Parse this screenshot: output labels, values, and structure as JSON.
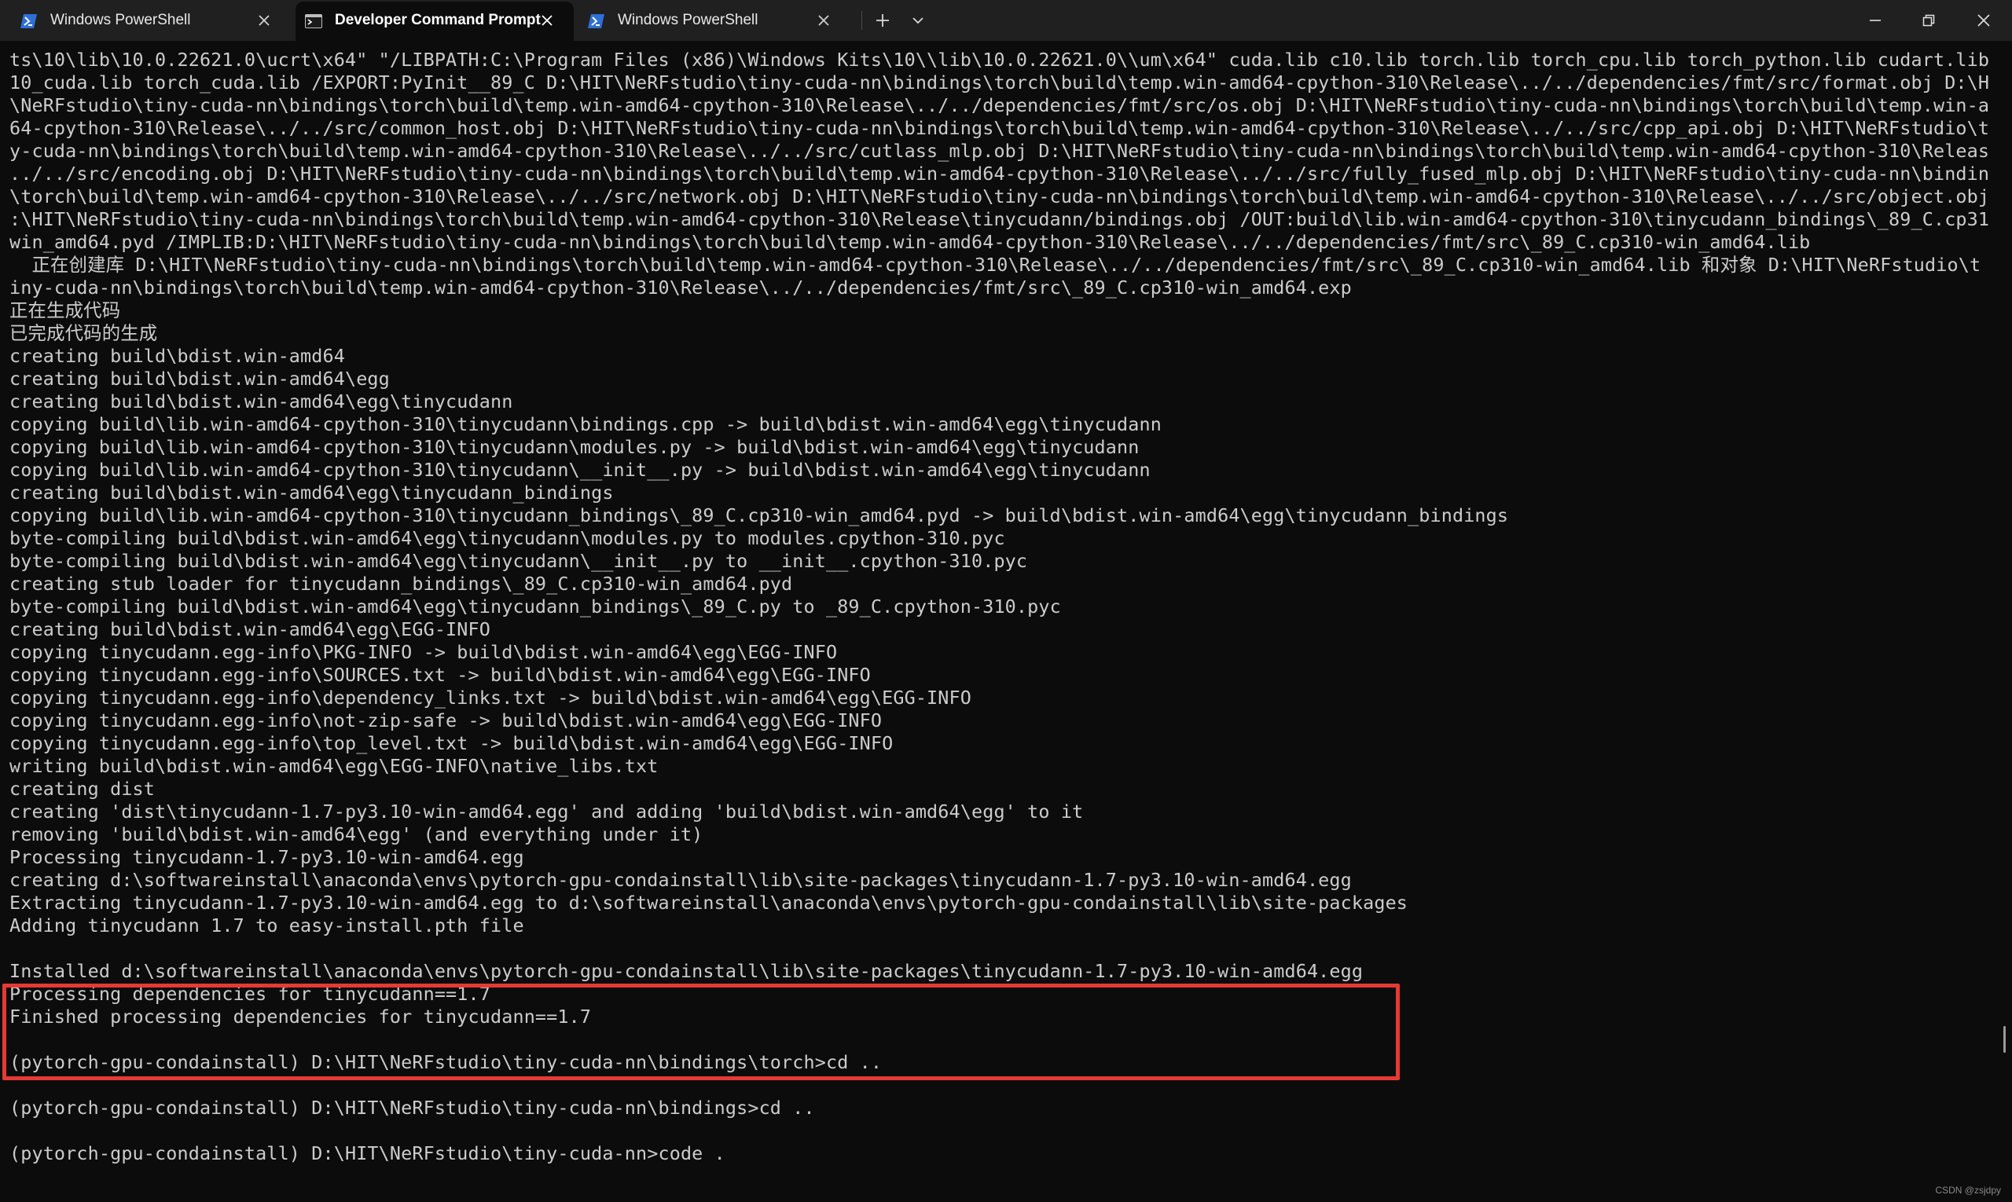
{
  "tabs": [
    {
      "label": "Windows PowerShell",
      "icon": "powershell-icon",
      "active": false
    },
    {
      "label": "Developer Command Prompt",
      "icon": "command-prompt-icon",
      "active": true
    },
    {
      "label": "Windows PowerShell",
      "icon": "powershell-icon",
      "active": false
    }
  ],
  "window_controls": [
    "minimize-icon",
    "maximize-icon",
    "close-icon"
  ],
  "colors": {
    "titlebar": "#202020",
    "terminal_bg": "#0c0c0c",
    "text": "#cccccc",
    "highlight_border": "#e53935",
    "powershell_icon": "#2f6fd6"
  },
  "terminal": {
    "lines": [
      "ts\\10\\lib\\10.0.22621.0\\ucrt\\x64\" \"/LIBPATH:C:\\Program Files (x86)\\Windows Kits\\10\\\\lib\\10.0.22621.0\\\\um\\x64\" cuda.lib c10.lib torch.lib torch_cpu.lib torch_python.lib cudart.lib c",
      "10_cuda.lib torch_cuda.lib /EXPORT:PyInit__89_C D:\\HIT\\NeRFstudio\\tiny-cuda-nn\\bindings\\torch\\build\\temp.win-amd64-cpython-310\\Release\\../../dependencies/fmt/src/format.obj D:\\HIT",
      "\\NeRFstudio\\tiny-cuda-nn\\bindings\\torch\\build\\temp.win-amd64-cpython-310\\Release\\../../dependencies/fmt/src/os.obj D:\\HIT\\NeRFstudio\\tiny-cuda-nn\\bindings\\torch\\build\\temp.win-amd",
      "64-cpython-310\\Release\\../../src/common_host.obj D:\\HIT\\NeRFstudio\\tiny-cuda-nn\\bindings\\torch\\build\\temp.win-amd64-cpython-310\\Release\\../../src/cpp_api.obj D:\\HIT\\NeRFstudio\\tin",
      "y-cuda-nn\\bindings\\torch\\build\\temp.win-amd64-cpython-310\\Release\\../../src/cutlass_mlp.obj D:\\HIT\\NeRFstudio\\tiny-cuda-nn\\bindings\\torch\\build\\temp.win-amd64-cpython-310\\Release\\",
      "../../src/encoding.obj D:\\HIT\\NeRFstudio\\tiny-cuda-nn\\bindings\\torch\\build\\temp.win-amd64-cpython-310\\Release\\../../src/fully_fused_mlp.obj D:\\HIT\\NeRFstudio\\tiny-cuda-nn\\bindings",
      "\\torch\\build\\temp.win-amd64-cpython-310\\Release\\../../src/network.obj D:\\HIT\\NeRFstudio\\tiny-cuda-nn\\bindings\\torch\\build\\temp.win-amd64-cpython-310\\Release\\../../src/object.obj D",
      ":\\HIT\\NeRFstudio\\tiny-cuda-nn\\bindings\\torch\\build\\temp.win-amd64-cpython-310\\Release\\tinycudann/bindings.obj /OUT:build\\lib.win-amd64-cpython-310\\tinycudann_bindings\\_89_C.cp310-",
      "win_amd64.pyd /IMPLIB:D:\\HIT\\NeRFstudio\\tiny-cuda-nn\\bindings\\torch\\build\\temp.win-amd64-cpython-310\\Release\\../../dependencies/fmt/src\\_89_C.cp310-win_amd64.lib",
      "  正在创建库 D:\\HIT\\NeRFstudio\\tiny-cuda-nn\\bindings\\torch\\build\\temp.win-amd64-cpython-310\\Release\\../../dependencies/fmt/src\\_89_C.cp310-win_amd64.lib 和对象 D:\\HIT\\NeRFstudio\\t",
      "iny-cuda-nn\\bindings\\torch\\build\\temp.win-amd64-cpython-310\\Release\\../../dependencies/fmt/src\\_89_C.cp310-win_amd64.exp",
      "正在生成代码",
      "已完成代码的生成",
      "creating build\\bdist.win-amd64",
      "creating build\\bdist.win-amd64\\egg",
      "creating build\\bdist.win-amd64\\egg\\tinycudann",
      "copying build\\lib.win-amd64-cpython-310\\tinycudann\\bindings.cpp -> build\\bdist.win-amd64\\egg\\tinycudann",
      "copying build\\lib.win-amd64-cpython-310\\tinycudann\\modules.py -> build\\bdist.win-amd64\\egg\\tinycudann",
      "copying build\\lib.win-amd64-cpython-310\\tinycudann\\__init__.py -> build\\bdist.win-amd64\\egg\\tinycudann",
      "creating build\\bdist.win-amd64\\egg\\tinycudann_bindings",
      "copying build\\lib.win-amd64-cpython-310\\tinycudann_bindings\\_89_C.cp310-win_amd64.pyd -> build\\bdist.win-amd64\\egg\\tinycudann_bindings",
      "byte-compiling build\\bdist.win-amd64\\egg\\tinycudann\\modules.py to modules.cpython-310.pyc",
      "byte-compiling build\\bdist.win-amd64\\egg\\tinycudann\\__init__.py to __init__.cpython-310.pyc",
      "creating stub loader for tinycudann_bindings\\_89_C.cp310-win_amd64.pyd",
      "byte-compiling build\\bdist.win-amd64\\egg\\tinycudann_bindings\\_89_C.py to _89_C.cpython-310.pyc",
      "creating build\\bdist.win-amd64\\egg\\EGG-INFO",
      "copying tinycudann.egg-info\\PKG-INFO -> build\\bdist.win-amd64\\egg\\EGG-INFO",
      "copying tinycudann.egg-info\\SOURCES.txt -> build\\bdist.win-amd64\\egg\\EGG-INFO",
      "copying tinycudann.egg-info\\dependency_links.txt -> build\\bdist.win-amd64\\egg\\EGG-INFO",
      "copying tinycudann.egg-info\\not-zip-safe -> build\\bdist.win-amd64\\egg\\EGG-INFO",
      "copying tinycudann.egg-info\\top_level.txt -> build\\bdist.win-amd64\\egg\\EGG-INFO",
      "writing build\\bdist.win-amd64\\egg\\EGG-INFO\\native_libs.txt",
      "creating dist",
      "creating 'dist\\tinycudann-1.7-py3.10-win-amd64.egg' and adding 'build\\bdist.win-amd64\\egg' to it",
      "removing 'build\\bdist.win-amd64\\egg' (and everything under it)",
      "Processing tinycudann-1.7-py3.10-win-amd64.egg",
      "creating d:\\softwareinstall\\anaconda\\envs\\pytorch-gpu-condainstall\\lib\\site-packages\\tinycudann-1.7-py3.10-win-amd64.egg",
      "Extracting tinycudann-1.7-py3.10-win-amd64.egg to d:\\softwareinstall\\anaconda\\envs\\pytorch-gpu-condainstall\\lib\\site-packages",
      "Adding tinycudann 1.7 to easy-install.pth file",
      "",
      "Installed d:\\softwareinstall\\anaconda\\envs\\pytorch-gpu-condainstall\\lib\\site-packages\\tinycudann-1.7-py3.10-win-amd64.egg",
      "Processing dependencies for tinycudann==1.7",
      "Finished processing dependencies for tinycudann==1.7",
      "",
      "(pytorch-gpu-condainstall) D:\\HIT\\NeRFstudio\\tiny-cuda-nn\\bindings\\torch>cd ..",
      "",
      "(pytorch-gpu-condainstall) D:\\HIT\\NeRFstudio\\tiny-cuda-nn\\bindings>cd ..",
      "",
      "(pytorch-gpu-condainstall) D:\\HIT\\NeRFstudio\\tiny-cuda-nn>code ."
    ]
  },
  "watermark": "CSDN @zsjdpy"
}
